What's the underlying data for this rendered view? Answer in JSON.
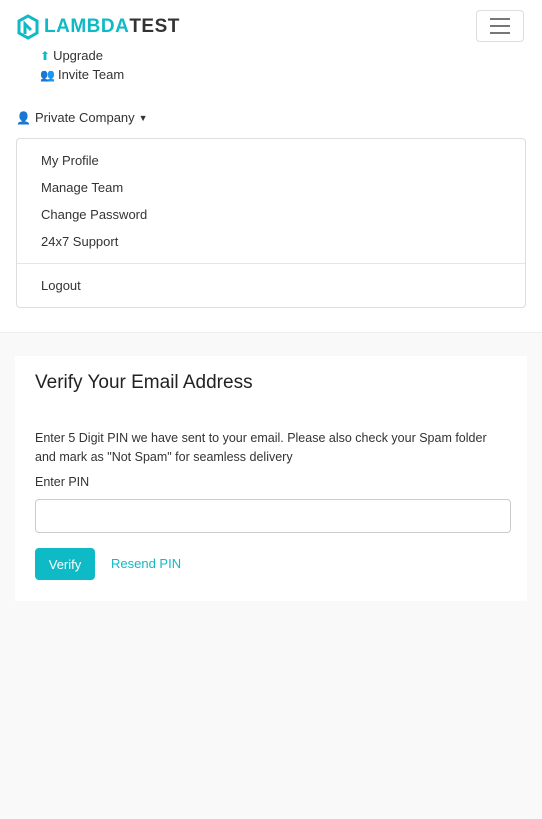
{
  "header": {
    "logo_text_a": "LAMBDA",
    "logo_text_b": "TEST",
    "upgrade": "Upgrade",
    "invite": "Invite Team",
    "company": "Private Company"
  },
  "menu": {
    "items": [
      "My Profile",
      "Manage Team",
      "Change Password",
      "24x7 Support"
    ],
    "logout": "Logout"
  },
  "card": {
    "title": "Verify Your Email Address",
    "description": "Enter 5 Digit PIN we have sent to your email. Please also check your Spam folder and mark as \"Not Spam\" for seamless delivery",
    "pin_label": "Enter PIN",
    "pin_value": "",
    "verify": "Verify",
    "resend": "Resend PIN"
  },
  "colors": {
    "accent": "#0ebac5"
  }
}
